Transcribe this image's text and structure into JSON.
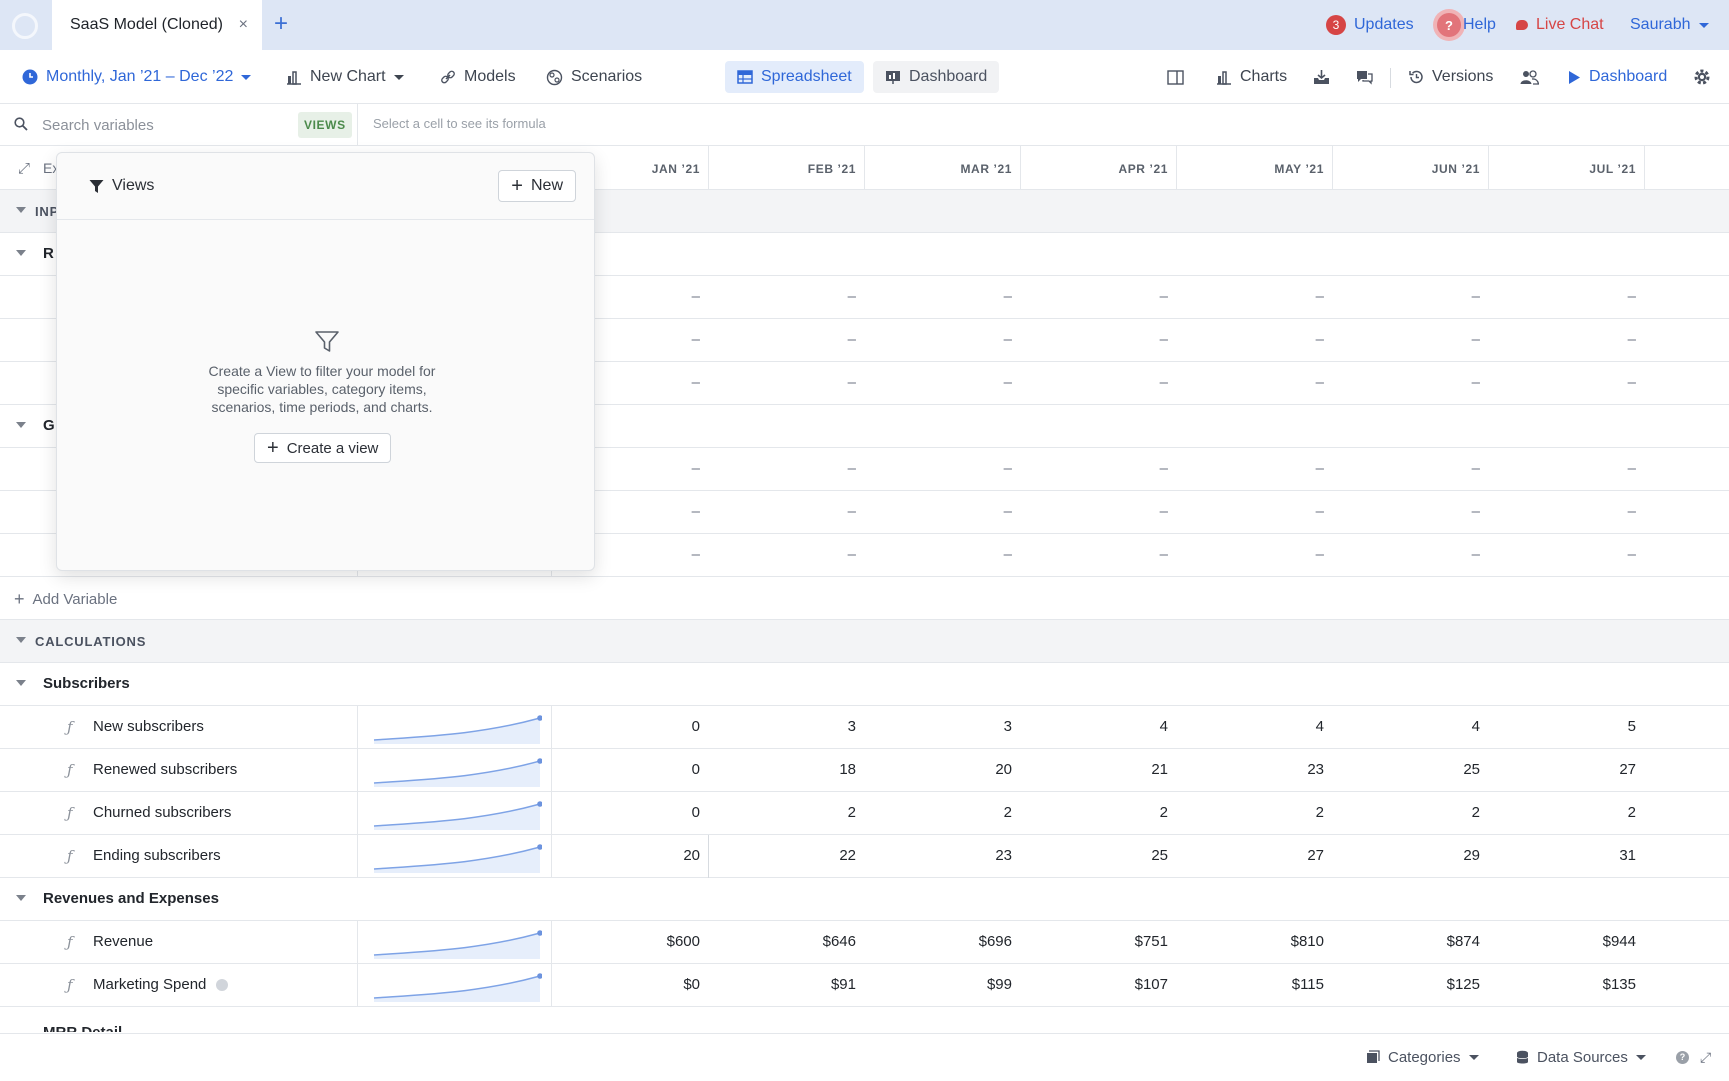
{
  "tabbar": {
    "tab_title": "SaaS Model (Cloned)",
    "close": "×",
    "new_tab": "+",
    "updates_count": "3",
    "updates_label": "Updates",
    "help_label": "Help",
    "live_chat_label": "Live Chat",
    "user_name": "Saurabh"
  },
  "toolbar": {
    "date_range": "Monthly, Jan ’21 – Dec ’22",
    "new_chart": "New Chart",
    "models": "Models",
    "scenarios": "Scenarios",
    "spreadsheet": "Spreadsheet",
    "dashboard_tab": "Dashboard",
    "charts": "Charts",
    "versions": "Versions",
    "dashboard_link": "Dashboard"
  },
  "search": {
    "placeholder": "Search variables",
    "views_button": "VIEWS",
    "formula_hint": "Select a cell to see its formula"
  },
  "grid": {
    "expand_label": "Ex",
    "months": [
      "JAN ’21",
      "FEB ’21",
      "MAR ’21",
      "APR ’21",
      "MAY ’21",
      "JUN ’21",
      "JUL ’21"
    ],
    "sections": {
      "inputs": "INP",
      "group_r": "R",
      "group_g": "G",
      "calculations": "CALCULATIONS",
      "subscribers": "Subscribers",
      "revenues": "Revenues and Expenses",
      "cutoff": "MRR Detail"
    },
    "dash": "–",
    "add_variable": "Add Variable",
    "rows": [
      {
        "label": "New subscribers",
        "values": [
          "0",
          "3",
          "3",
          "4",
          "4",
          "4",
          "5"
        ]
      },
      {
        "label": "Renewed subscribers",
        "values": [
          "0",
          "18",
          "20",
          "21",
          "23",
          "25",
          "27"
        ]
      },
      {
        "label": "Churned subscribers",
        "values": [
          "0",
          "2",
          "2",
          "2",
          "2",
          "2",
          "2"
        ]
      },
      {
        "label": "Ending subscribers",
        "values": [
          "20",
          "22",
          "23",
          "25",
          "27",
          "29",
          "31"
        ]
      },
      {
        "label": "Revenue",
        "values": [
          "$600",
          "$646",
          "$696",
          "$751",
          "$810",
          "$874",
          "$944"
        ]
      },
      {
        "label": "Marketing Spend",
        "values": [
          "$0",
          "$91",
          "$99",
          "$107",
          "$115",
          "$125",
          "$135"
        ]
      }
    ]
  },
  "views_popover": {
    "title": "Views",
    "new_button": "New",
    "message": "Create a View to filter your model for specific variables, category items, scenarios, time periods, and charts.",
    "create_button": "Create a view"
  },
  "bottombar": {
    "categories": "Categories",
    "data_sources": "Data Sources"
  },
  "colors": {
    "accent": "#2f67d8",
    "tabbar_bg": "#dde6f5",
    "alert": "#d64545",
    "views_green": "#4b8a4b"
  }
}
